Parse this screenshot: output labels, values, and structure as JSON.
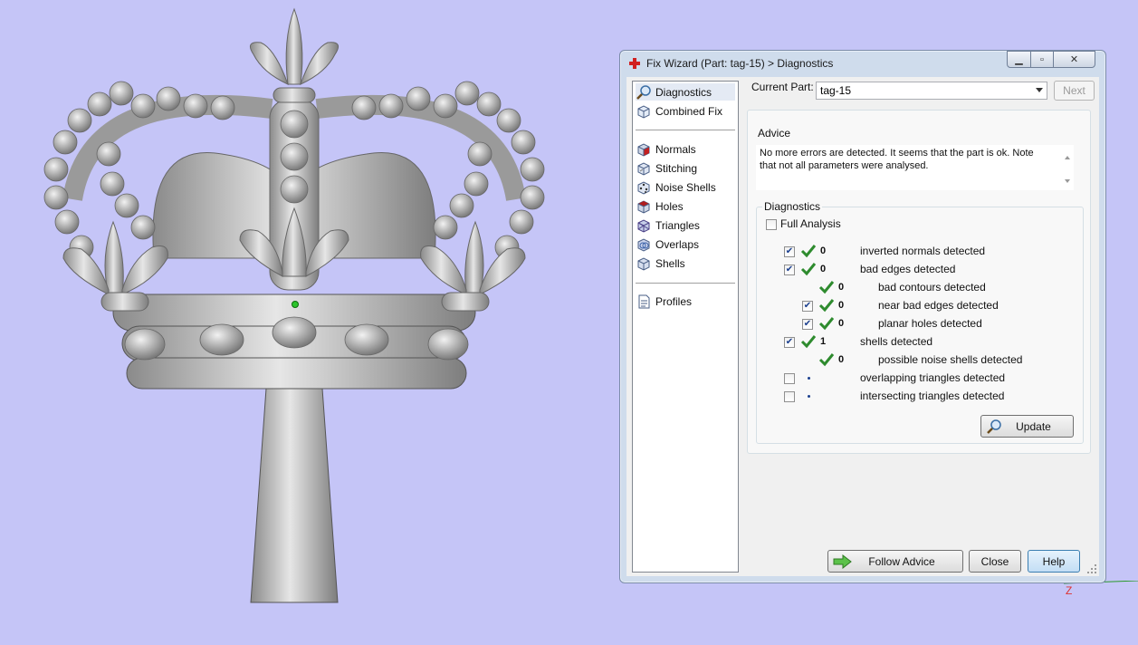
{
  "viewport": {
    "axis_label": "Z"
  },
  "window": {
    "title": "Fix Wizard (Part: tag-15) > Diagnostics"
  },
  "sidebar": {
    "items": [
      {
        "label": "Diagnostics",
        "icon": "magnifier-icon",
        "selected": true
      },
      {
        "label": "Combined Fix",
        "icon": "cube-wire-icon"
      },
      {
        "label": "Normals",
        "icon": "cube-red-icon"
      },
      {
        "label": "Stitching",
        "icon": "cube-stitch-icon"
      },
      {
        "label": "Noise Shells",
        "icon": "cube-dots-icon"
      },
      {
        "label": "Holes",
        "icon": "cube-hole-icon"
      },
      {
        "label": "Triangles",
        "icon": "cube-triangles-icon"
      },
      {
        "label": "Overlaps",
        "icon": "cube-overlap-icon"
      },
      {
        "label": "Shells",
        "icon": "cube-shells-icon"
      },
      {
        "label": "Profiles",
        "icon": "document-icon"
      }
    ]
  },
  "current_part": {
    "label": "Current Part:",
    "value": "tag-15"
  },
  "buttons": {
    "next": "Next",
    "update": "Update",
    "follow_advice": "Follow Advice",
    "close": "Close",
    "help": "Help"
  },
  "advice": {
    "title": "Advice",
    "text_line1": "No more errors are detected. It seems that the part is ok. Note",
    "text_line2": "that not all parameters were analysed."
  },
  "diagnostics": {
    "title": "Diagnostics",
    "full_analysis": {
      "label": "Full Analysis",
      "checked": false
    },
    "rows": [
      {
        "checked": true,
        "status": "ok",
        "count": "0",
        "label": "inverted normals detected",
        "indent": 0
      },
      {
        "checked": true,
        "status": "ok",
        "count": "0",
        "label": "bad edges detected",
        "indent": 0
      },
      {
        "checkbox": false,
        "status": "ok",
        "count": "0",
        "label": "bad contours detected",
        "indent": 1
      },
      {
        "checked": true,
        "status": "ok",
        "count": "0",
        "label": "near bad edges detected",
        "indent": 1
      },
      {
        "checked": true,
        "status": "ok",
        "count": "0",
        "label": "planar holes detected",
        "indent": 1
      },
      {
        "checked": true,
        "status": "ok",
        "count": "1",
        "label": "shells detected",
        "indent": 0
      },
      {
        "checkbox": false,
        "status": "ok",
        "count": "0",
        "label": "possible noise shells detected",
        "indent": 1
      },
      {
        "checked": false,
        "status": "none",
        "count": "",
        "label": "overlapping triangles detected",
        "indent": 0
      },
      {
        "checked": false,
        "status": "none",
        "count": "",
        "label": "intersecting triangles detected",
        "indent": 0
      }
    ]
  },
  "colors": {
    "background": "#c5c5f7",
    "window_frame": "#cfdcec",
    "check_green": "#2e8b2e"
  }
}
